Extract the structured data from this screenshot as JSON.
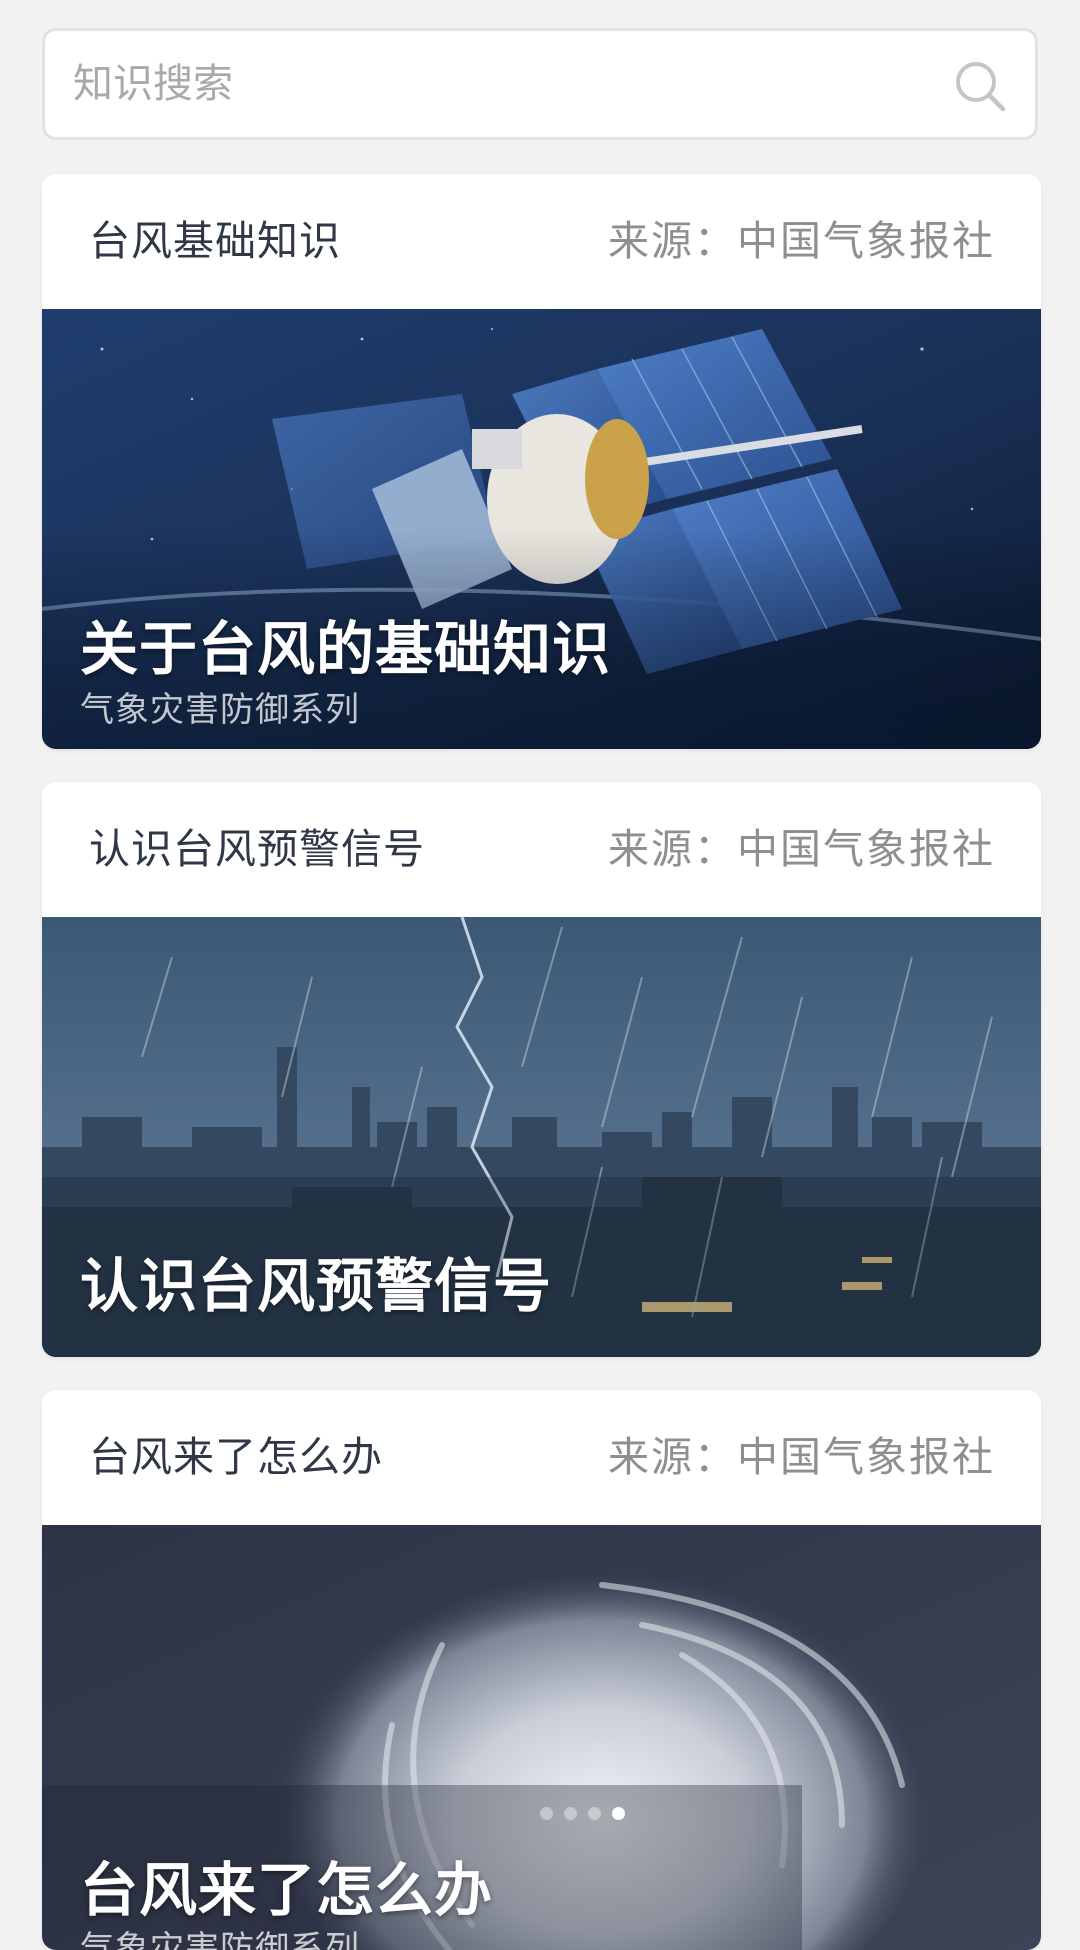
{
  "search": {
    "placeholder": "知识搜索"
  },
  "cards": [
    {
      "header_title": "台风基础知识",
      "source": "来源：中国气象报社",
      "overlay_title": "关于台风的基础知识",
      "overlay_subtitle": "气象灾害防御系列"
    },
    {
      "header_title": "认识台风预警信号",
      "source": "来源：中国气象报社",
      "overlay_title": "认识台风预警信号"
    },
    {
      "header_title": "台风来了怎么办",
      "source": "来源：中国气象报社",
      "overlay_title": "台风来了怎么办",
      "overlay_subtitle": "气象灾害防御系列"
    }
  ],
  "carousel": {
    "dot_count": 4,
    "active_index": 3
  },
  "colors": {
    "background": "#f2f2f3",
    "title_text": "#2f3846",
    "source_text": "#8e8e93"
  },
  "icons": {
    "search": "search-icon"
  }
}
